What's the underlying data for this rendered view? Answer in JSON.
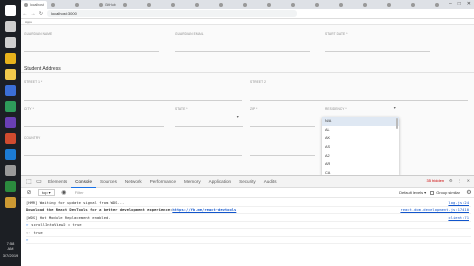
{
  "taskbar": {
    "icons": [
      {
        "name": "windows-icon",
        "color": "#ffffff"
      },
      {
        "name": "search-icon",
        "color": "#cfcfcf"
      },
      {
        "name": "task-view-icon",
        "color": "#cfcfcf"
      },
      {
        "name": "chrome-icon",
        "color": "#e8b31c"
      },
      {
        "name": "explorer-icon",
        "color": "#f2c94c"
      },
      {
        "name": "app-icon",
        "color": "#3b6fd6"
      },
      {
        "name": "app-icon",
        "color": "#2e9b5a"
      },
      {
        "name": "app-icon",
        "color": "#6a3fb5"
      },
      {
        "name": "app-icon",
        "color": "#d04b2f"
      },
      {
        "name": "app-icon",
        "color": "#1c7bd4"
      },
      {
        "name": "app-icon",
        "color": "#999999"
      },
      {
        "name": "app-icon",
        "color": "#2b8a3e"
      },
      {
        "name": "app-icon",
        "color": "#c93"
      }
    ],
    "time": "7:58",
    "ampm": "AM",
    "date": "3/7/2019"
  },
  "browser": {
    "tabs": [
      "localhost",
      "",
      "",
      "GitHub",
      "",
      "",
      "",
      "",
      "",
      "",
      "",
      "",
      "",
      "",
      "",
      "",
      "",
      ""
    ],
    "url": "localhost:3000",
    "window_controls": [
      "–",
      "□",
      "✕"
    ]
  },
  "bookmarks": [
    "Apps",
    "",
    "",
    "",
    "",
    "",
    "",
    "",
    "",
    "",
    "",
    ""
  ],
  "form": {
    "row1": [
      "GUARDIAN NAME",
      "GUARDIAN EMAIL",
      "START DATE *"
    ],
    "section_title": "Student Address",
    "row2": [
      "STREET 1 *",
      "STREET 2"
    ],
    "row3": [
      "CITY *",
      "STATE *",
      "ZIP *",
      "RESIDENCY *"
    ],
    "row4": [
      "COUNTRY"
    ]
  },
  "dropdown": {
    "options": [
      "N/A",
      "AL",
      "AK",
      "AS",
      "A2",
      "AR",
      "CA"
    ],
    "selected_index": 0
  },
  "devtools": {
    "tabs": [
      "Elements",
      "Console",
      "Sources",
      "Network",
      "Performance",
      "Memory",
      "Application",
      "Security",
      "Audits"
    ],
    "active_tab": "Console",
    "hidden_count": "35 hidden",
    "context": "top",
    "filter_placeholder": "Filter",
    "levels": "Default levels ▾",
    "group_similar": "Group similar",
    "console_lines": [
      {
        "type": "log",
        "text": "[HMR] Waiting for update signal from WDS...",
        "source": "log.js:24"
      },
      {
        "type": "bold",
        "text": "Download the React DevTools for a better development experience: ",
        "link": "https://fb.me/react-devtools",
        "source": "react-dom.development.js:17410"
      },
      {
        "type": "log",
        "text": "[WDS] Hot Module Replacement enabled.",
        "source": "client:71"
      },
      {
        "type": "input",
        "text": "scrollIntoView2 = true"
      },
      {
        "type": "result",
        "text": "true"
      },
      {
        "type": "prompt",
        "text": ""
      }
    ]
  }
}
